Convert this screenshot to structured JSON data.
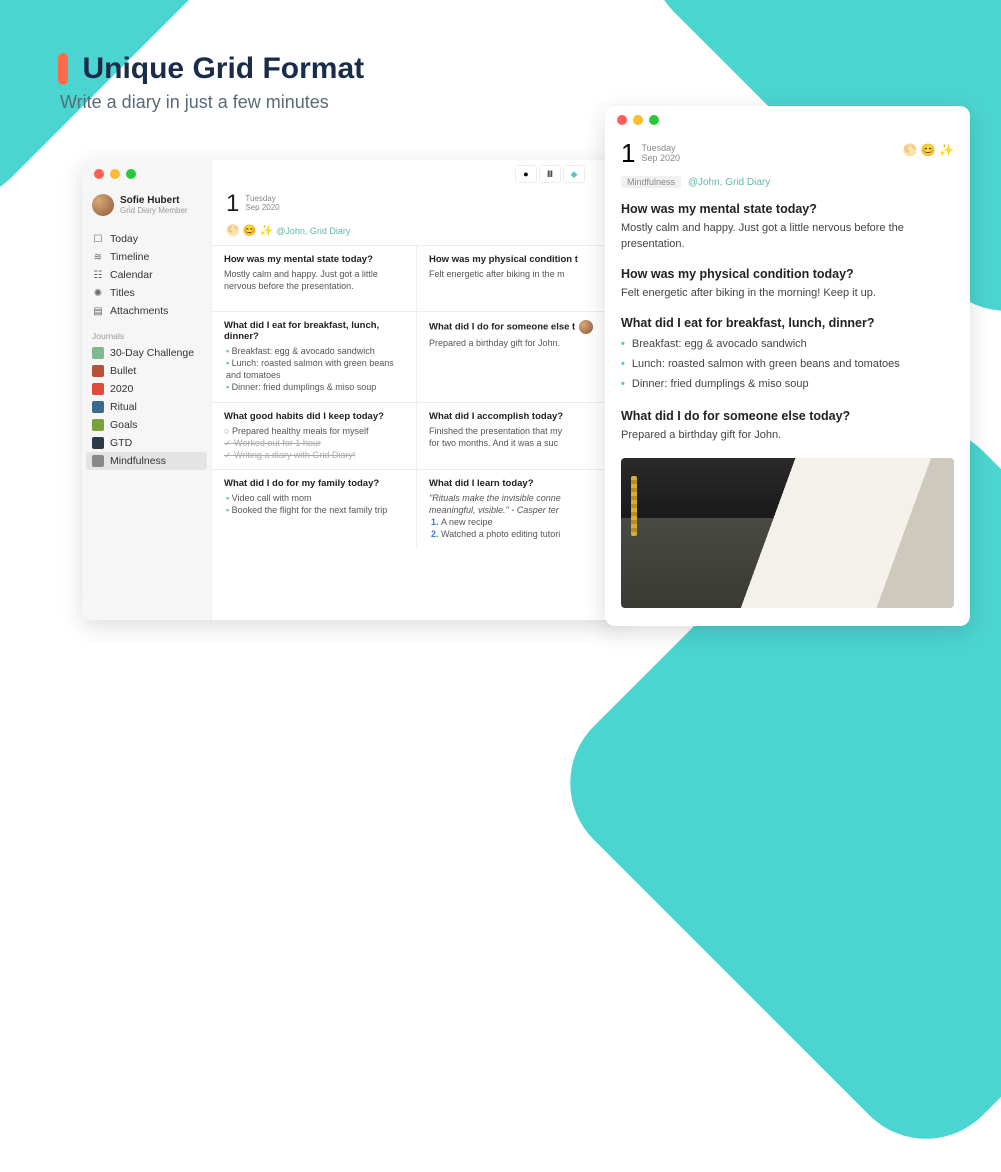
{
  "hero": {
    "title": "Unique Grid Format",
    "subtitle": "Write a diary in just a few minutes"
  },
  "leftWindow": {
    "profile": {
      "name": "Sofie Hubert",
      "role": "Grid Diary Member"
    },
    "nav": [
      {
        "label": "Today",
        "icon": "☐"
      },
      {
        "label": "Timeline",
        "icon": "≋"
      },
      {
        "label": "Calendar",
        "icon": "☷"
      },
      {
        "label": "Titles",
        "icon": "✺"
      },
      {
        "label": "Attachments",
        "icon": "▤"
      }
    ],
    "journalsLabel": "Journals",
    "journals": [
      {
        "label": "30-Day Challenge",
        "color": "#7fb98f"
      },
      {
        "label": "Bullet",
        "color": "#b4533a"
      },
      {
        "label": "2020",
        "color": "#e04a3a"
      },
      {
        "label": "Ritual",
        "color": "#3a6a8c"
      },
      {
        "label": "Goals",
        "color": "#7aa23a"
      },
      {
        "label": "GTD",
        "color": "#2a3a4a"
      },
      {
        "label": "Mindfulness",
        "color": "#888",
        "active": true
      }
    ],
    "date": {
      "dayNum": "1",
      "weekday": "Tuesday",
      "month": "Sep 2020"
    },
    "moods": "🌕 😊 ✨",
    "tagPrefix": "@",
    "tags": "@John, Grid Diary",
    "grid": [
      {
        "q": "How was my mental state today?",
        "a_text": "Mostly calm and happy. Just got a little nervous before the presentation."
      },
      {
        "q": "How was my physical condition t",
        "a_text": "Felt energetic after biking in the m"
      },
      {
        "q": "What did I eat for breakfast, lunch, dinner?",
        "a_list": [
          "Breakfast: egg & avocado sandwich",
          "Lunch: roasted salmon with green beans and tomatoes",
          "Dinner: fried dumplings & miso soup"
        ]
      },
      {
        "q": "What did I do for someone else t",
        "a_text": "Prepared a birthday gift for John.",
        "avatar": true
      },
      {
        "q": "What good habits did I keep today?",
        "a_habits": [
          {
            "text": "Prepared healthy meals for myself",
            "kind": "circle"
          },
          {
            "text": "Worked out for 1 hour",
            "kind": "strike"
          },
          {
            "text": "Writing a diary with Grid Diary!",
            "kind": "strike"
          }
        ]
      },
      {
        "q": "What did I accomplish today?",
        "a_text": "Finished the presentation that my\nfor two months. And it was a suc"
      },
      {
        "q": "What did I do for my family today?",
        "a_list": [
          "Video call with mom",
          "Booked the flight for the next family trip"
        ]
      },
      {
        "q": "What did I learn today?",
        "a_quote": "\"Rituals make the invisible conne\nmeaningful, visible.\" - Casper ter",
        "a_ord": [
          "A new recipe",
          "Watched a photo editing tutori"
        ]
      }
    ]
  },
  "rightWindow": {
    "date": {
      "dayNum": "1",
      "weekday": "Tuesday",
      "month": "Sep 2020"
    },
    "moods": "🌕 😊 ✨",
    "tagPill": "Mindfulness",
    "tags": "@John, Grid Diary",
    "entries": [
      {
        "q": "How was my mental state today?",
        "a_text": "Mostly calm and happy. Just got a little nervous before the presentation."
      },
      {
        "q": "How was my physical condition today?",
        "a_text": "Felt energetic after biking in the morning! Keep it up."
      },
      {
        "q": "What did I eat for breakfast, lunch, dinner?",
        "a_list": [
          "Breakfast: egg & avocado sandwich",
          "Lunch: roasted salmon with green beans and tomatoes",
          "Dinner: fried dumplings & miso soup"
        ]
      },
      {
        "q": "What did I do for someone else today?",
        "a_text": "Prepared a birthday gift for John."
      }
    ]
  }
}
